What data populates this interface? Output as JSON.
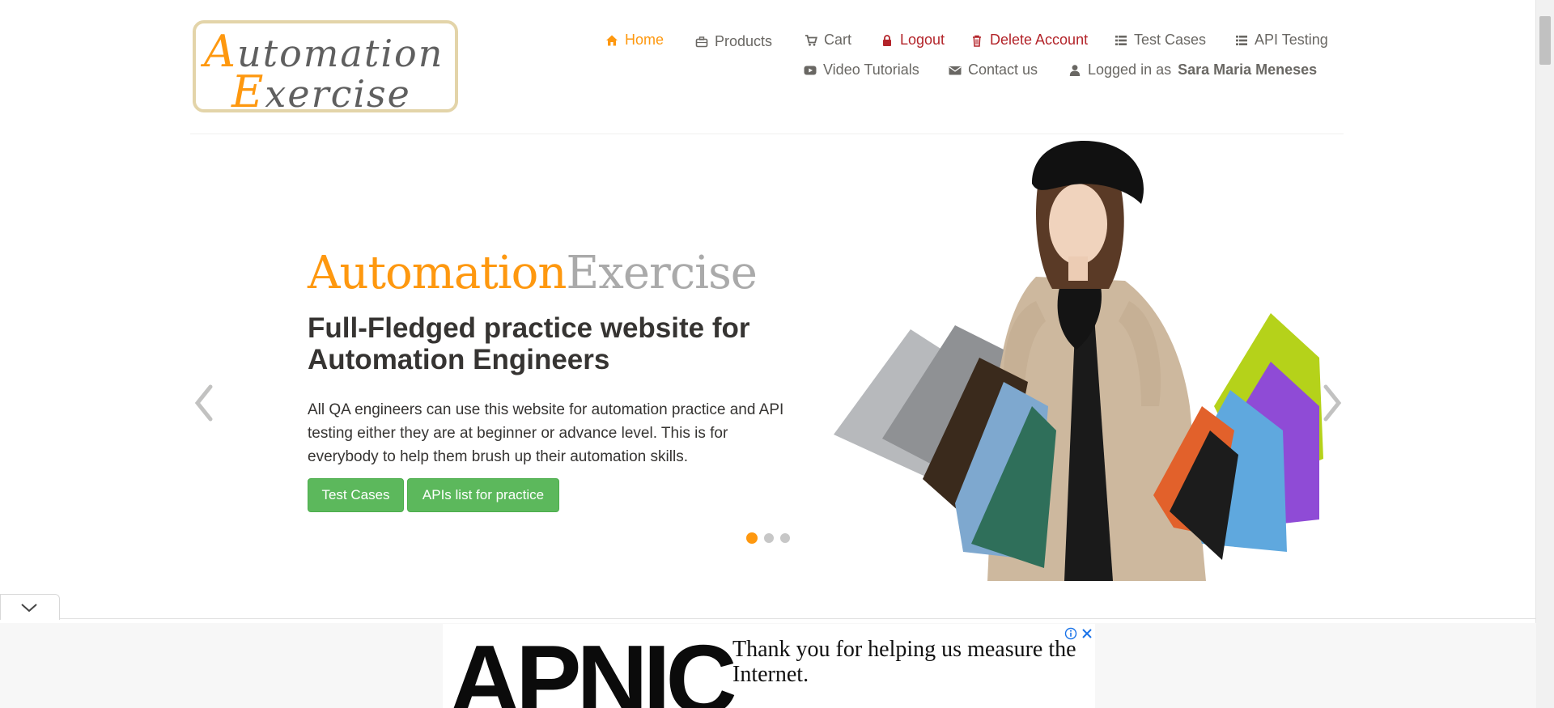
{
  "logo": {
    "line1_cap": "A",
    "line1_rest": "utomation",
    "line2_cap": "E",
    "line2_rest": "xercise"
  },
  "nav": {
    "home": "Home",
    "products": "Products",
    "cart": "Cart",
    "logout": "Logout",
    "delete_account": "Delete Account",
    "test_cases": "Test Cases",
    "api_testing": "API Testing",
    "video_tutorials": "Video Tutorials",
    "contact_us": "Contact us",
    "logged_in_prefix": "Logged in as",
    "logged_in_user": "Sara Maria Meneses"
  },
  "slider": {
    "brand_part1": "Automation",
    "brand_part2": "Exercise",
    "headline": "Full-Fledged practice website for Automation Engineers",
    "description": "All QA engineers can use this website for automation practice and API testing either they are at beginner or advance level. This is for everybody to help them brush up their automation skills.",
    "btn_test_cases": "Test Cases",
    "btn_apis": "APIs list for practice",
    "slide_count": 3,
    "active_slide": 1
  },
  "ad": {
    "brand": "APNIC",
    "message": "Thank you for helping us measure the Internet."
  },
  "colors": {
    "accent": "#fe980f",
    "danger": "#b3242a",
    "button_green": "#5cb85c",
    "text": "#696763"
  }
}
